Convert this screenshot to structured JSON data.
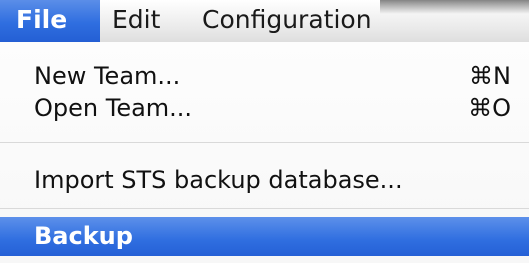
{
  "menubar": {
    "menus": [
      {
        "label": "File"
      },
      {
        "label": "Edit"
      },
      {
        "label": "Configuration"
      }
    ]
  },
  "file_menu": {
    "items": [
      {
        "label": "New Team...",
        "shortcut": "⌘N"
      },
      {
        "label": "Open Team...",
        "shortcut": "⌘O"
      },
      {
        "label": "Import STS backup database..."
      },
      {
        "label": "Backup"
      }
    ]
  },
  "colors": {
    "highlight": "#2f6ee0",
    "menubar_bg": "#e9e9e9",
    "menu_bg": "#f8f8f8"
  }
}
